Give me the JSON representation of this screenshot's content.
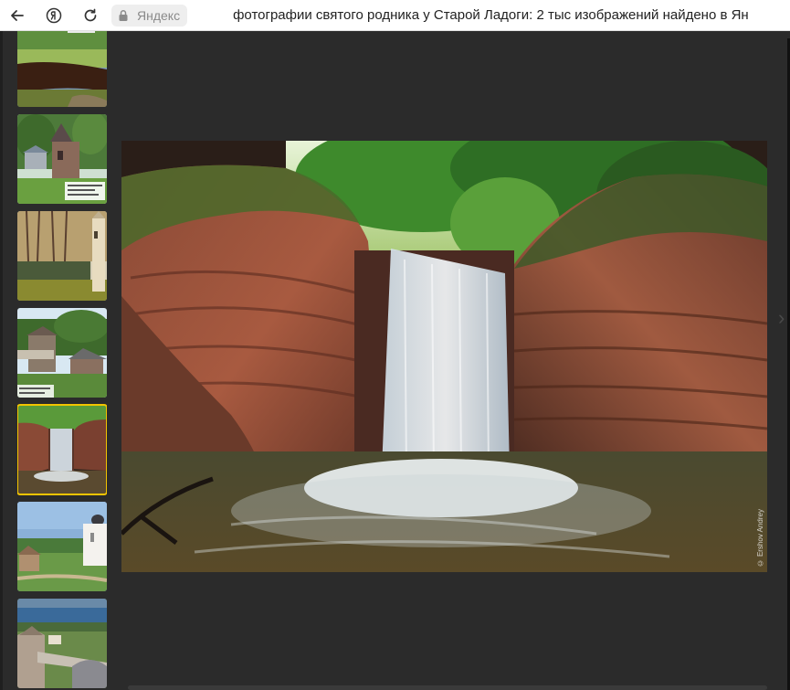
{
  "browser": {
    "back_icon": "arrow-left-icon",
    "yandex_icon": "yandex-logo-icon",
    "reload_icon": "reload-icon",
    "lock_icon": "lock-icon",
    "site_name": "Яндекс",
    "page_title": "фотографии святого родника у Старой Ладоги: 2 тыс изображений найдено в Ян"
  },
  "viewer": {
    "thumbnails": [
      {
        "name": "thumb-river"
      },
      {
        "name": "thumb-wooden-chapel"
      },
      {
        "name": "thumb-autumn-pond-bell-tower"
      },
      {
        "name": "thumb-wooden-houses"
      },
      {
        "name": "thumb-waterfall",
        "selected": true
      },
      {
        "name": "thumb-white-church"
      },
      {
        "name": "thumb-fortress-aerial"
      }
    ],
    "main_image": {
      "subject": "waterfall in red sandstone canyon",
      "credit": "© Ershov Andrey"
    },
    "accent_color": "#f2c400"
  }
}
